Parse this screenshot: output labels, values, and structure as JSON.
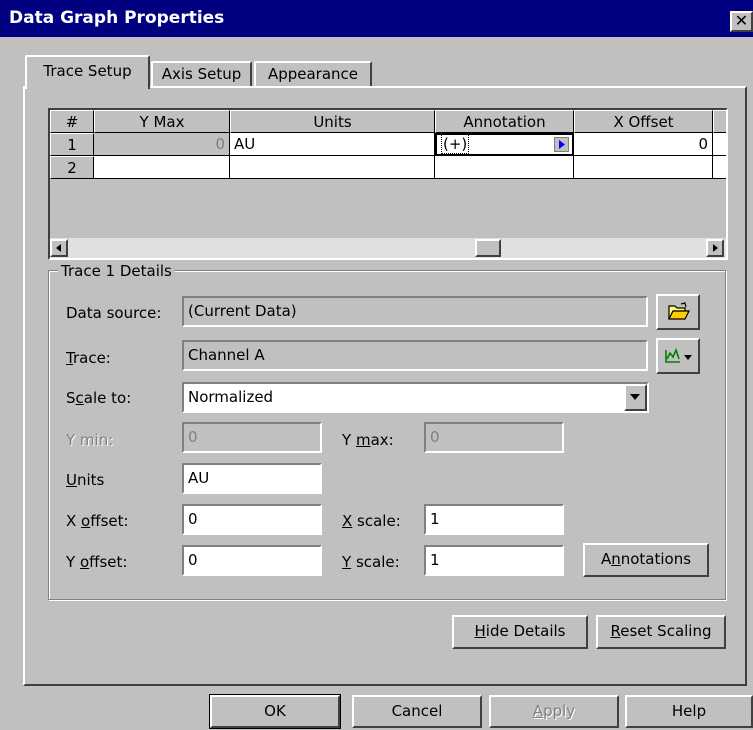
{
  "window": {
    "title": "Data Graph Properties",
    "close_symbol": "✕"
  },
  "tabs": [
    {
      "label": "Trace Setup",
      "active": true
    },
    {
      "label": "Axis Setup",
      "active": false
    },
    {
      "label": "Appearance",
      "active": false
    }
  ],
  "grid": {
    "columns": [
      "#",
      "Y Max",
      "Units",
      "Annotation",
      "X Offset"
    ],
    "rows": [
      {
        "num": "1",
        "ymax": "0",
        "units": "AU",
        "annotation": "(+)",
        "xoffset": "0"
      },
      {
        "num": "2",
        "ymax": "",
        "units": "",
        "annotation": "",
        "xoffset": ""
      }
    ]
  },
  "details": {
    "group_title": "Trace 1 Details",
    "data_source": {
      "label": "Data source:",
      "value": "(Current Data)"
    },
    "trace": {
      "label_pre": "",
      "label_u": "T",
      "label_post": "race:",
      "value": "Channel A"
    },
    "scale_to": {
      "label_pre": "S",
      "label_u": "c",
      "label_post": "ale to:",
      "value": "Normalized"
    },
    "y_min": {
      "label": "Y min:",
      "value": "0"
    },
    "y_max": {
      "label_pre": "Y ",
      "label_u": "m",
      "label_post": "ax:",
      "value": "0"
    },
    "units": {
      "label_u": "U",
      "label_post": "nits",
      "value": "AU"
    },
    "x_offset": {
      "label_pre": "X ",
      "label_u": "o",
      "label_post": "ffset:",
      "value": "0"
    },
    "x_scale": {
      "label_u": "X",
      "label_post": " scale:",
      "value": "1"
    },
    "y_offset": {
      "label_pre": "Y ",
      "label_u": "o",
      "label_post": "ffset:",
      "value": "0"
    },
    "y_scale": {
      "label_u": "Y",
      "label_post": " scale:",
      "value": "1"
    },
    "annotations_button": {
      "pre": "A",
      "u": "n",
      "post": "notations"
    }
  },
  "panel_buttons": {
    "hide_details": {
      "u": "H",
      "post": "ide Details"
    },
    "reset_scaling": {
      "u": "R",
      "post": "eset Scaling"
    }
  },
  "dialog_buttons": {
    "ok": "OK",
    "cancel": "Cancel",
    "apply": {
      "u": "A",
      "post": "pply"
    },
    "help": "Help"
  }
}
